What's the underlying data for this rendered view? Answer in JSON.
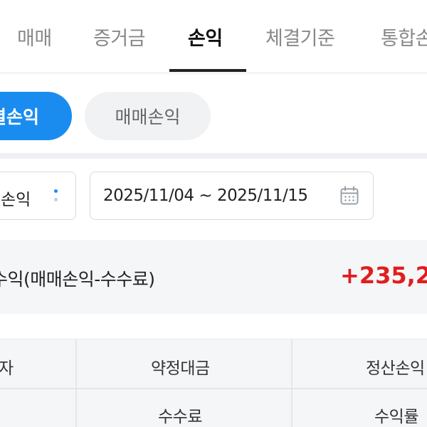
{
  "tabs": [
    {
      "label": "매매"
    },
    {
      "label": "증거금"
    },
    {
      "label": "손익"
    },
    {
      "label": "체결기준"
    },
    {
      "label": "통합손"
    }
  ],
  "filters": {
    "primary_label": "결손익",
    "secondary_label": "매매손익"
  },
  "controls": {
    "dropdown_label": "손익",
    "date_range": "2025/11/04 ~ 2025/11/15"
  },
  "summary": {
    "label": "수익(매매손익-수수료)",
    "value": "+235,2"
  },
  "table": {
    "headers_row1": [
      "자",
      "약정대금",
      "정산손익"
    ],
    "headers_row2": [
      "수수료",
      "수익률"
    ]
  },
  "colors": {
    "accent": "#1a8cf0",
    "profit": "#e01e1e"
  },
  "icons": {
    "more": "more-vertical-icon",
    "calendar": "calendar-icon"
  }
}
